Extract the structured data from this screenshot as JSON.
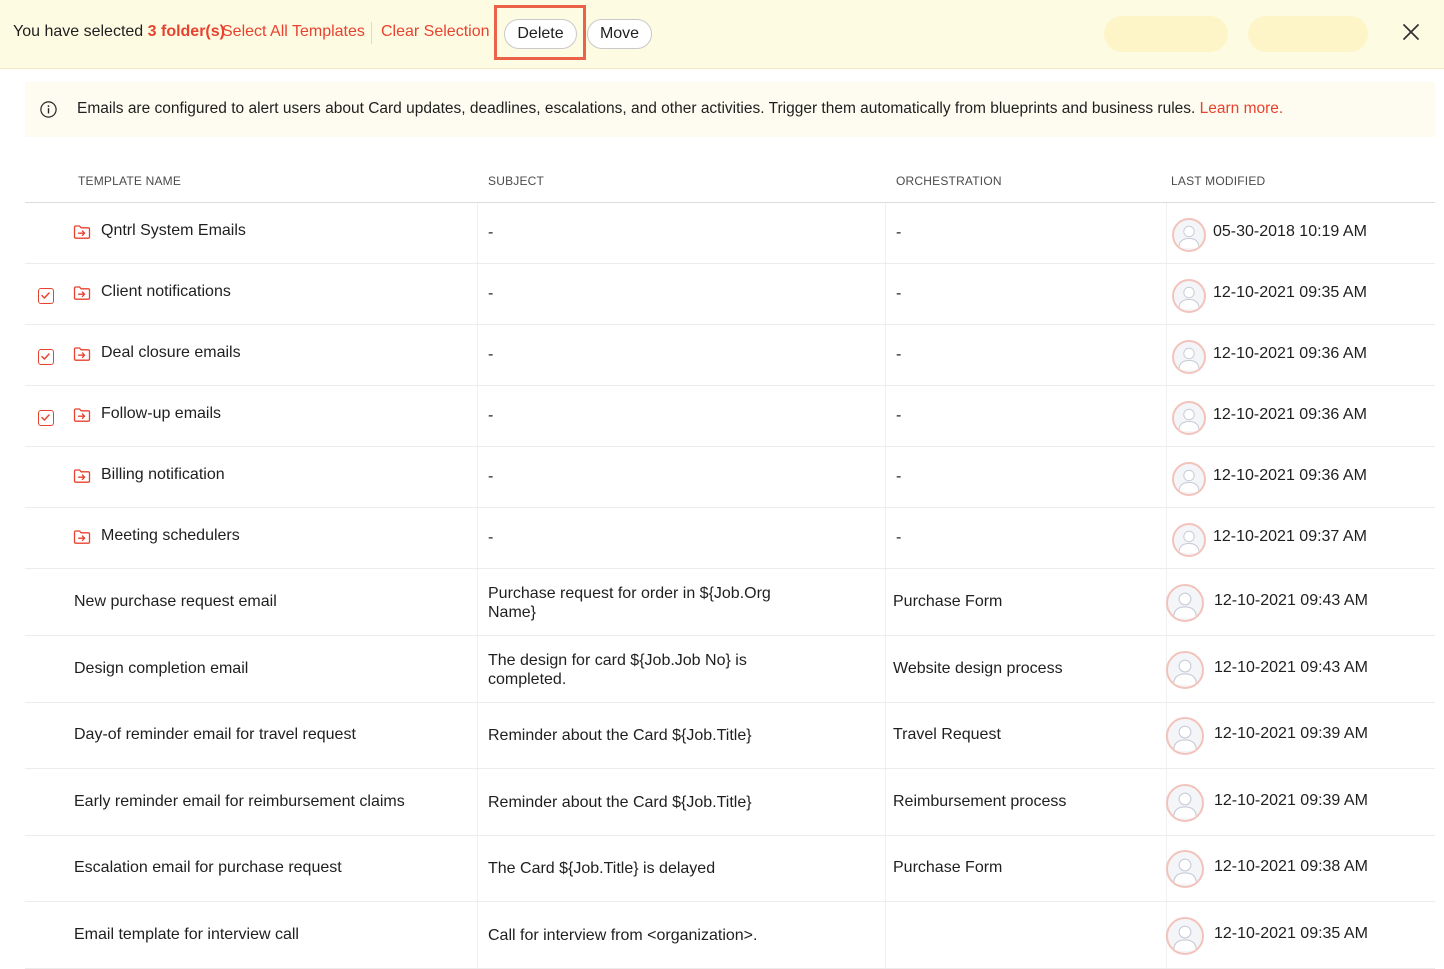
{
  "selection_bar": {
    "prefix": "You have selected",
    "count_text": "3 folder(s)",
    "select_all_label": "Select All Templates",
    "clear_selection_label": "Clear Selection",
    "delete_label": "Delete",
    "move_label": "Move",
    "close_icon": "close-icon"
  },
  "info_banner": {
    "icon": "info-icon",
    "message": "Emails are configured to alert users about Card updates, deadlines, escalations, and other activities. Trigger them automatically from blueprints and business rules.",
    "link_label": "Learn more."
  },
  "table": {
    "headers": {
      "template_name": "TEMPLATE NAME",
      "subject": "SUBJECT",
      "orchestration": "ORCHESTRATION",
      "last_modified": "LAST MODIFIED"
    },
    "folders": [
      {
        "name": "Qntrl System Emails",
        "subject": "-",
        "orchestration": "-",
        "last_modified": "05-30-2018 10:19 AM",
        "selectable": false,
        "checked": false
      },
      {
        "name": "Client notifications",
        "subject": "-",
        "orchestration": "-",
        "last_modified": "12-10-2021 09:35 AM",
        "selectable": true,
        "checked": true
      },
      {
        "name": "Deal closure emails",
        "subject": "-",
        "orchestration": "-",
        "last_modified": "12-10-2021 09:36 AM",
        "selectable": true,
        "checked": true
      },
      {
        "name": "Follow-up emails",
        "subject": "-",
        "orchestration": "-",
        "last_modified": "12-10-2021 09:36 AM",
        "selectable": true,
        "checked": true
      },
      {
        "name": "Billing notification",
        "subject": "-",
        "orchestration": "-",
        "last_modified": "12-10-2021 09:36 AM",
        "selectable": false,
        "checked": false
      },
      {
        "name": "Meeting schedulers",
        "subject": "-",
        "orchestration": "-",
        "last_modified": "12-10-2021 09:37 AM",
        "selectable": false,
        "checked": false
      }
    ],
    "templates": [
      {
        "name": "New purchase request email",
        "subject_lines": [
          "Purchase request for order in ${Job.Org",
          "Name}"
        ],
        "orchestration": "Purchase Form",
        "last_modified": "12-10-2021 09:43 AM"
      },
      {
        "name": "Design completion email",
        "subject_lines": [
          "The design for card ${Job.Job No} is",
          "completed."
        ],
        "orchestration": "Website design process",
        "last_modified": "12-10-2021 09:43 AM"
      },
      {
        "name": "Day-of reminder email for travel request",
        "subject_lines": [
          "Reminder about the Card ${Job.Title}"
        ],
        "orchestration": "Travel Request",
        "last_modified": "12-10-2021 09:39 AM"
      },
      {
        "name": "Early reminder email for reimbursement claims",
        "subject_lines": [
          "Reminder about the Card ${Job.Title}"
        ],
        "orchestration": "Reimbursement process",
        "last_modified": "12-10-2021 09:39 AM"
      },
      {
        "name": "Escalation email for purchase request",
        "subject_lines": [
          "The Card ${Job.Title} is delayed"
        ],
        "orchestration": "Purchase Form",
        "last_modified": "12-10-2021 09:38 AM"
      },
      {
        "name": "Email template for interview call",
        "subject_lines": [
          "Call for interview from <organization>."
        ],
        "orchestration": "",
        "last_modified": "12-10-2021 09:35 AM"
      }
    ]
  },
  "colors": {
    "accent": "#e8422f",
    "selection_bar_bg": "#fefbe3",
    "info_banner_bg": "#fefcf0",
    "highlight": "#e96249"
  }
}
